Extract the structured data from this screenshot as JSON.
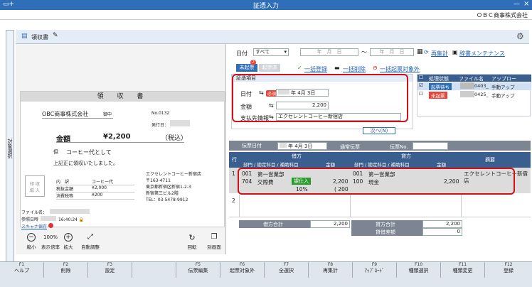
{
  "window": {
    "title": "証憑入力",
    "company": "ＯＢＣ商事株式会社"
  },
  "side_tab": {
    "label": "対象選択"
  },
  "doc": {
    "title": "領収書"
  },
  "receipt": {
    "title": "領 収 書",
    "payee": "OBC商事株式会社",
    "honorific": "御中",
    "no_label": "No.0132",
    "issue_label": "発行日：",
    "amount_label": "金額",
    "amount_value": "¥2,200",
    "tax_note": "（税込）",
    "memo_prefix": "但",
    "memo": "コーヒー代として",
    "received": "上記正に領収いたしました。",
    "stamp": "印 収\n紙 入",
    "table": [
      {
        "k": "内　訳",
        "v": "コーヒー代"
      },
      {
        "k": "税抜金額",
        "v": "¥2,000"
      },
      {
        "k": "消費税等",
        "v": "¥200"
      }
    ],
    "issuer": [
      "エクセレントコーヒー新宿店",
      "〒163-4711",
      "東京都新宿区新宿1-2-3",
      "新宿第三ビル2階",
      "TEL：03-5478-9912"
    ]
  },
  "file_info": {
    "file_label": "ファイル名：",
    "ref_label": "参照日時",
    "time": "16:40:24",
    "scanner": "スキャナ保存"
  },
  "left_toolbar": [
    {
      "icon": "−",
      "label": "縮小"
    },
    {
      "icon": "100%",
      "label": "表示倍率"
    },
    {
      "icon": "+",
      "label": "拡大"
    },
    {
      "icon": "⤢",
      "label": "自動調整"
    },
    {
      "icon": "↻",
      "label": "回転"
    },
    {
      "icon": "❐",
      "label": "別画面"
    }
  ],
  "filters": {
    "date_label": "日付",
    "date_select": "すべて",
    "from_placeholder": "年　月　日",
    "to_placeholder": "年　月　日",
    "tilde": "〜",
    "recalc": "再集計",
    "dict": "辞書メンテナンス"
  },
  "tabs": {
    "unprocessed": "未起票",
    "badge": "2",
    "processed": "起票済"
  },
  "actions": {
    "bulk_register": "一括登録",
    "bulk_delete": "一括削除",
    "bulk_target": "一括起票対象外"
  },
  "voucher_items": {
    "title": "証憑項目",
    "date_label": "日付",
    "date_tag": "必須",
    "date_value": "年  4月  3日",
    "amount_label": "金額",
    "amount_value": "2,200",
    "payee_label": "支払先情報",
    "payee_value": "エクセレントコーヒー新宿店",
    "next": "次へ(N)"
  },
  "file_list": {
    "headers": [
      "処理状態",
      "ファイル名",
      "アップロー"
    ],
    "rows": [
      {
        "status": "起票待ち",
        "file": "0403_",
        "up": "手動アップ",
        "checked": true
      },
      {
        "status": "未起票",
        "file": "0425_",
        "up": "手動アップ",
        "checked": false
      }
    ]
  },
  "slip": {
    "date_label": "伝票日付",
    "date_value": "年  4月  3日",
    "type": "通常伝票",
    "no_label": "伝票No."
  },
  "journal": {
    "col_row": "行",
    "debit": "借方",
    "credit": "貸方",
    "summary": "摘要",
    "sub_headers": [
      "部門 / 勘定科目 / 補助科目",
      "金額",
      "部門 / 勘定科目 / 補助科目",
      "金額"
    ],
    "row1": {
      "no": "1",
      "dr_dept_code": "001",
      "dr_dept": "第一営業部",
      "dr_acct_code": "704",
      "dr_acct": "交際費",
      "tax_badge": "課仕入",
      "tax_rate": "10%",
      "dr_amount": "2,200",
      "dr_tax": "( 200",
      "cr_dept_code": "001",
      "cr_dept": "第一営業部",
      "cr_acct_code": "100",
      "cr_acct": "現金",
      "cr_amount": "2,200",
      "summary": "エクセレントコーヒー新宿店"
    },
    "row2": {
      "no": "2"
    },
    "dr_total_label": "借方合計",
    "dr_total": "2,200",
    "cr_total_label": "貸方合計",
    "cr_total": "2,200",
    "diff_label": "貸借差額",
    "diff": "0"
  },
  "fkeys": [
    {
      "n": "F1",
      "label": "ヘルプ"
    },
    {
      "n": "F2",
      "label": "削除"
    },
    {
      "n": "F3",
      "label": "設定"
    },
    {
      "n": "",
      "label": ""
    },
    {
      "n": "F5",
      "label": "伝票編集"
    },
    {
      "n": "F6",
      "label": "起票対象外"
    },
    {
      "n": "F7",
      "label": "全選択"
    },
    {
      "n": "F8",
      "label": "再集計"
    },
    {
      "n": "F9",
      "label": "ｱｯﾌﾟﾛｰﾄﾞ"
    },
    {
      "n": "F10",
      "label": "種類選択"
    },
    {
      "n": "F11",
      "label": "種類変更"
    },
    {
      "n": "F12",
      "label": "登録"
    }
  ],
  "colors": {
    "title_bar": "#2f6fb8",
    "highlight": "#d0101a",
    "grid_header": "#3a5f8f"
  }
}
